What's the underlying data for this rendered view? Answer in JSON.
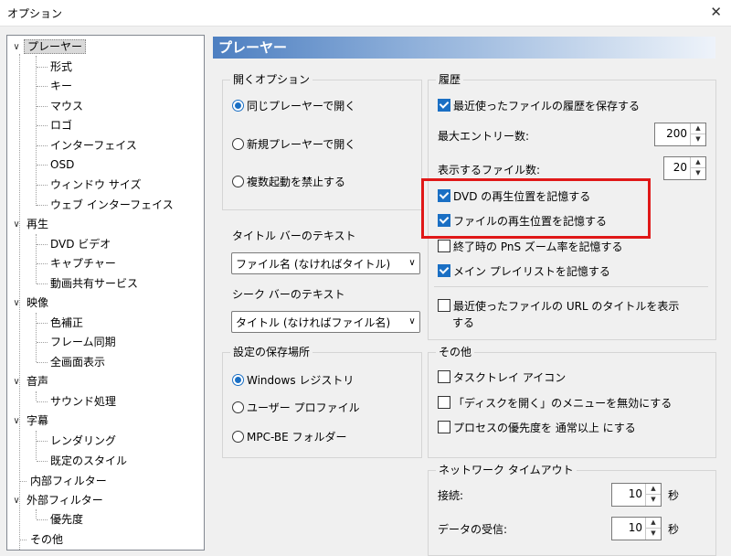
{
  "window": {
    "title": "オプション",
    "close_glyph": "✕"
  },
  "tree": {
    "items": [
      {
        "label": "プレーヤー"
      },
      {
        "label": "形式"
      },
      {
        "label": "キー"
      },
      {
        "label": "マウス"
      },
      {
        "label": "ロゴ"
      },
      {
        "label": "インターフェイス"
      },
      {
        "label": "OSD"
      },
      {
        "label": "ウィンドウ サイズ"
      },
      {
        "label": "ウェブ インターフェイス"
      },
      {
        "label": "再生"
      },
      {
        "label": "DVD ビデオ"
      },
      {
        "label": "キャプチャー"
      },
      {
        "label": "動画共有サービス"
      },
      {
        "label": "映像"
      },
      {
        "label": "色補正"
      },
      {
        "label": "フレーム同期"
      },
      {
        "label": "全画面表示"
      },
      {
        "label": "音声"
      },
      {
        "label": "サウンド処理"
      },
      {
        "label": "字幕"
      },
      {
        "label": "レンダリング"
      },
      {
        "label": "既定のスタイル"
      },
      {
        "label": "内部フィルター"
      },
      {
        "label": "外部フィルター"
      },
      {
        "label": "優先度"
      },
      {
        "label": "その他"
      }
    ]
  },
  "page": {
    "title": "プレーヤー"
  },
  "open_options": {
    "label": "開くオプション",
    "radios": [
      "同じプレーヤーで開く",
      "新規プレーヤーで開く",
      "複数起動を禁止する"
    ]
  },
  "title_bar_text": {
    "label": "タイトル バーのテキスト",
    "value": "ファイル名 (なければタイトル)"
  },
  "seek_bar_text": {
    "label": "シーク バーのテキスト",
    "value": "タイトル (なければファイル名)"
  },
  "settings_location": {
    "label": "設定の保存場所",
    "radios": [
      "Windows レジストリ",
      "ユーザー プロファイル",
      "MPC-BE フォルダー"
    ]
  },
  "history": {
    "label": "履歴",
    "save_recent": "最近使ったファイルの履歴を保存する",
    "max_entries_label": "最大エントリー数:",
    "max_entries_value": "200",
    "display_files_label": "表示するファイル数:",
    "display_files_value": "20",
    "remember_dvd": "DVD の再生位置を記憶する",
    "remember_file": "ファイルの再生位置を記憶する",
    "remember_zoom": "終了時の PnS ズーム率を記憶する",
    "remember_playlist": "メイン プレイリストを記憶する",
    "recent_url_line1": "最近使ったファイルの URL のタイトルを表示",
    "recent_url_line2": "する"
  },
  "other": {
    "label": "その他",
    "tray_icon": "タスクトレイ アイコン",
    "disable_open_disc": "「ディスクを開く」のメニューを無効にする",
    "process_priority": "プロセスの優先度を 通常以上 にする"
  },
  "network": {
    "label": "ネットワーク タイムアウト",
    "connect_label": "接続:",
    "connect_value": "10",
    "receive_label": "データの受信:",
    "receive_value": "10",
    "unit": "秒"
  },
  "colors": {
    "accent": "#1a6fc4",
    "highlight_box": "#e01818"
  }
}
